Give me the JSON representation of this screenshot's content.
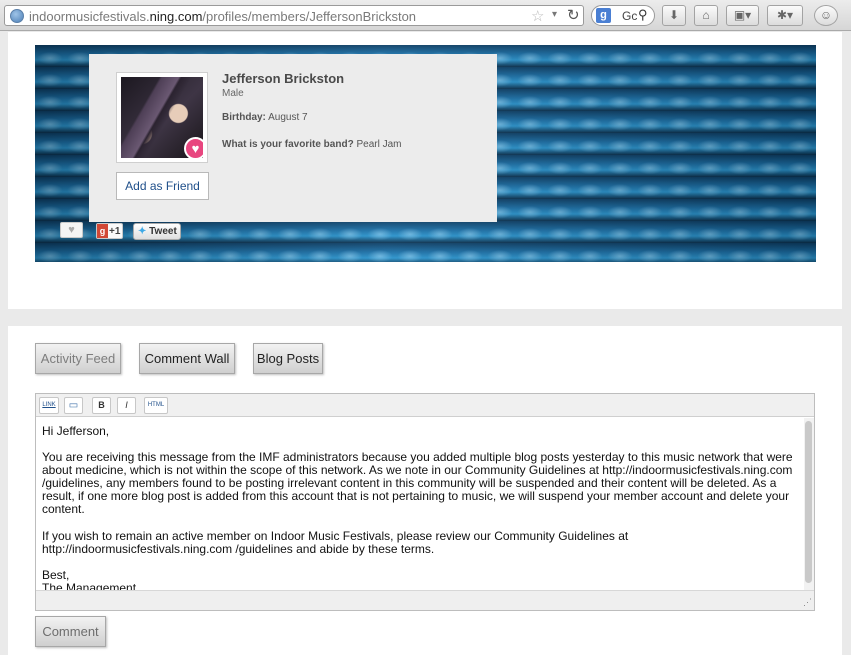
{
  "browser": {
    "url_prefix": "indoormusicfestivals.",
    "url_domain": "ning.com",
    "url_path": "/profiles/members/JeffersonBrickston",
    "search_engine_letter": "g",
    "search_text": "Gc",
    "icons": {
      "globe": "globe-icon",
      "bookmark": "star-icon",
      "reload": "reload-icon",
      "download": "download-icon",
      "home": "home-icon",
      "screenshot": "screenshot-icon",
      "extension": "bug-icon",
      "addon": "monkey-icon"
    }
  },
  "profile": {
    "name": "Jefferson Brickston",
    "gender": "Male",
    "birthday_label": "Birthday:",
    "birthday_value": "August 7",
    "question_label": "What is your favorite band?",
    "question_value": "Pearl Jam",
    "add_friend": "Add as Friend"
  },
  "share": {
    "like": "♥",
    "gplus": "+1",
    "tweet": "Tweet"
  },
  "tabs": [
    {
      "label": "Activity Feed",
      "active": false
    },
    {
      "label": "Comment Wall",
      "active": true
    },
    {
      "label": "Blog Posts",
      "active": true
    }
  ],
  "editor": {
    "tools": {
      "link": "LINK",
      "image": "▭",
      "bold": "B",
      "italic": "I",
      "html": "HTML"
    },
    "greeting": "Hi Jefferson,",
    "paragraph1": "You are receiving this message from the IMF administrators because you added multiple blog posts yesterday to this music network that were about medicine, which is not within the scope of this network.  As we note in our Community Guidelines at http://indoormusicfestivals.ning.com /guidelines, any members found to be posting irrelevant content in this community will be suspended and their content will be deleted.  As a result, if one more blog post is added from this account that is not pertaining to music, we will suspend your member account and delete your content.",
    "paragraph2": "If you wish to remain an active member on Indoor Music Festivals, please review our Community Guidelines at http://indoormusicfestivals.ning.com /guidelines and abide by these terms.",
    "closing_line1": "Best,",
    "closing_line2": "The Management"
  },
  "submit_label": "Comment"
}
